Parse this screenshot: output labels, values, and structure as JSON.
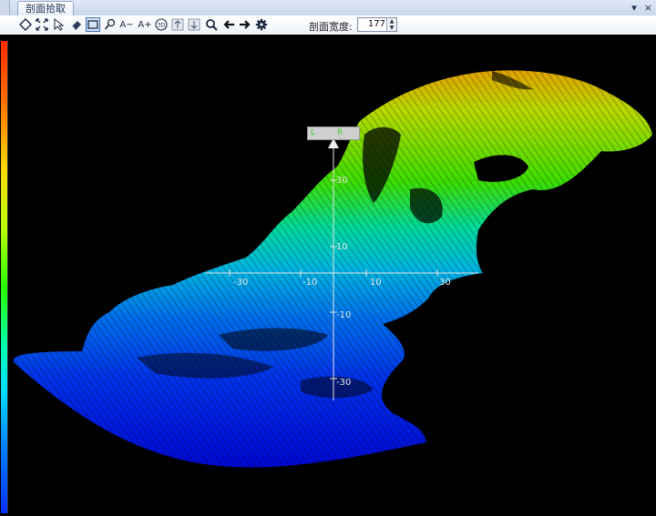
{
  "window": {
    "tab_title": "剖面拾取",
    "pin_glyph": "▾",
    "close_glyph": "×"
  },
  "toolbar": {
    "tools": [
      {
        "name": "rotate-diamond-icon",
        "glyph": "◇"
      },
      {
        "name": "fit-extent-icon",
        "glyph": "⤧"
      },
      {
        "name": "select-arrow-icon",
        "glyph": "↖"
      },
      {
        "name": "eraser-icon",
        "glyph": "◆"
      },
      {
        "name": "rectangle-select-icon",
        "glyph": "▭",
        "active": true
      },
      {
        "name": "zoom-pan-icon",
        "glyph": "⚲"
      },
      {
        "name": "decrease-font-icon",
        "glyph": "A−"
      },
      {
        "name": "increase-font-icon",
        "glyph": "A+"
      },
      {
        "name": "3d-view-icon",
        "glyph": "3D"
      },
      {
        "name": "raise-section-icon",
        "glyph": "⇡"
      },
      {
        "name": "lower-section-icon",
        "glyph": "⇣"
      },
      {
        "name": "magnifier-icon",
        "glyph": "🔍"
      },
      {
        "name": "arrow-left-icon",
        "glyph": "←"
      },
      {
        "name": "arrow-right-icon",
        "glyph": "→"
      },
      {
        "name": "settings-gear-icon",
        "glyph": "⚙"
      }
    ],
    "section_width_label": "剖面宽度:",
    "section_width_value": "177"
  },
  "viewport": {
    "marker": {
      "left_text": "L",
      "right_text": "R"
    },
    "x_axis_ticks": [
      "-30",
      "-10",
      "10",
      "30"
    ],
    "y_axis_ticks": [
      "30",
      "10",
      "-10",
      "-30"
    ]
  },
  "colors": {
    "background": "#000000",
    "axis": "#e6e6e6",
    "high": "#d9a400",
    "mid": "#22e000",
    "low": "#0010e0"
  }
}
